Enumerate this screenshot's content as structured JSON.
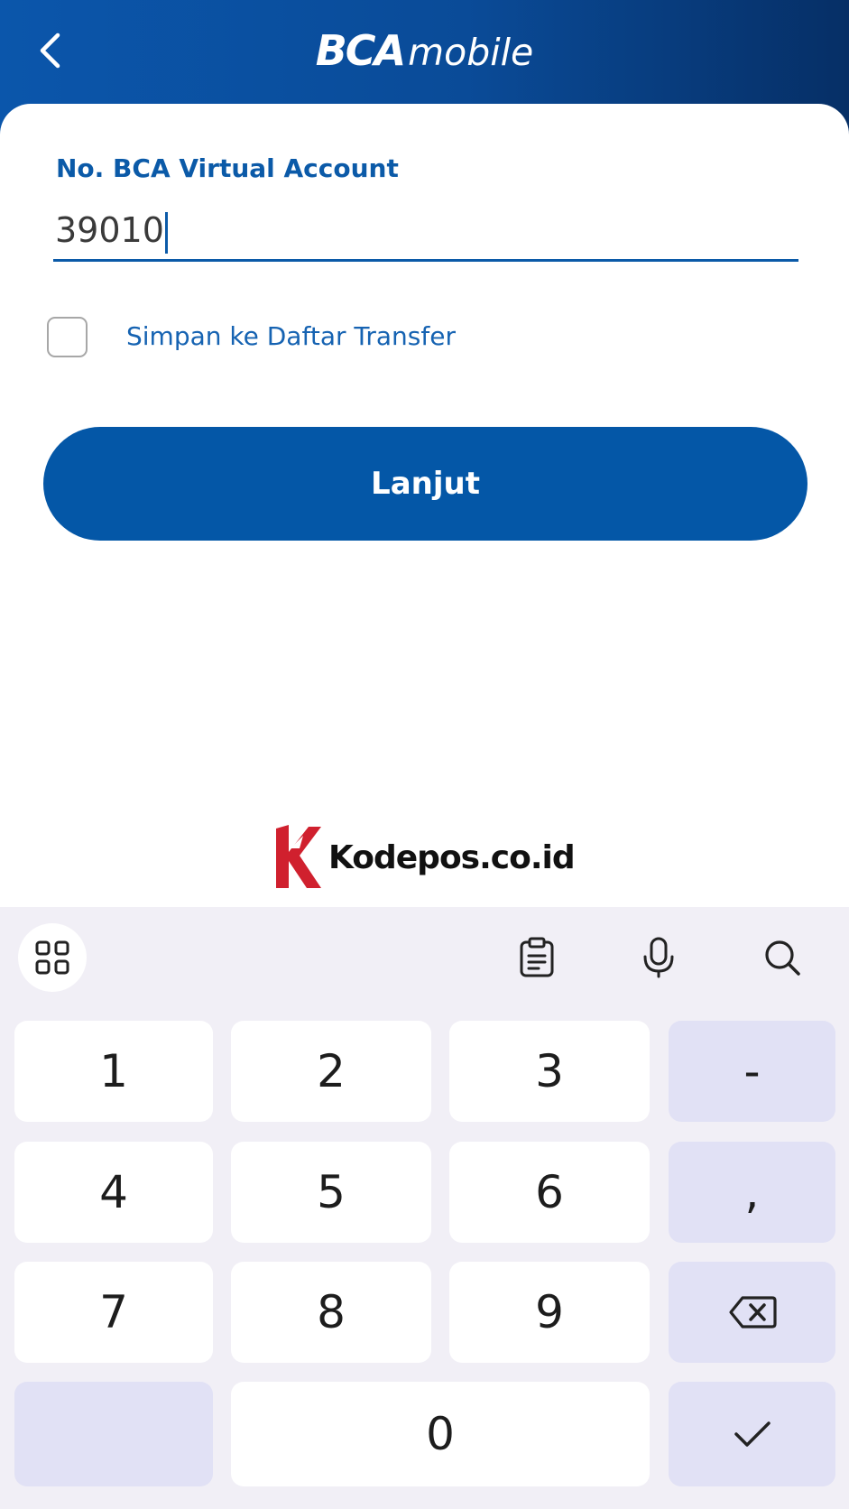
{
  "app": {
    "logo_bold": "BCA",
    "logo_italic": "mobile",
    "accent_color": "#0457a7"
  },
  "header": {
    "back_icon": "chevron-left-icon"
  },
  "form": {
    "field_label": "No. BCA Virtual Account",
    "field_value": "39010",
    "save_checkbox_checked": false,
    "save_checkbox_label": "Simpan ke Daftar Transfer",
    "submit_label": "Lanjut"
  },
  "watermark": {
    "text": "Kodepos.co.id"
  },
  "keyboard": {
    "toolbar_icons": [
      "grid-icon",
      "clipboard-icon",
      "microphone-icon",
      "search-icon"
    ],
    "keys": {
      "k1": "1",
      "k2": "2",
      "k3": "3",
      "dash": "-",
      "k4": "4",
      "k5": "5",
      "k6": "6",
      "comma": ",",
      "k7": "7",
      "k8": "8",
      "k9": "9",
      "k0": "0"
    },
    "backspace_icon": "backspace-icon",
    "enter_icon": "checkmark-icon"
  }
}
